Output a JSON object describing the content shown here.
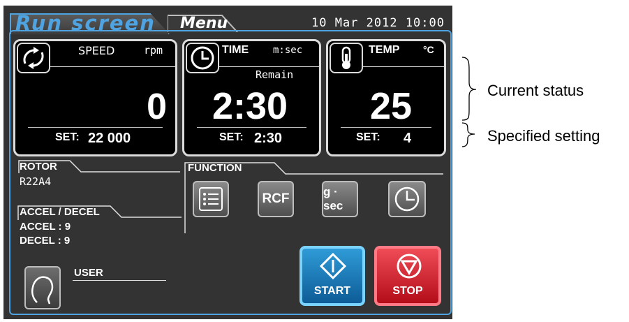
{
  "header": {
    "run_tab": "Run screen",
    "menu_tab": "Menu",
    "datetime": "10 Mar 2012 10:00"
  },
  "speed": {
    "label": "SPEED",
    "unit": "rpm",
    "value": "0",
    "set_label": "SET:",
    "set_value": "22 000",
    "icon": "rotation-icon"
  },
  "time": {
    "label": "TIME",
    "unit": "m:sec",
    "sublabel": "Remain",
    "value": "2:30",
    "set_label": "SET:",
    "set_value": "2:30",
    "icon": "clock-icon"
  },
  "temp": {
    "label": "TEMP",
    "unit": "°C",
    "value": "25",
    "set_label": "SET:",
    "set_value": "4",
    "icon": "thermometer-icon"
  },
  "rotor": {
    "label": "ROTOR",
    "value": "R22A4"
  },
  "accel_decel": {
    "label": "ACCEL / DECEL",
    "accel": "ACCEL : 9",
    "decel": "DECEL : 9"
  },
  "function": {
    "label": "FUNCTION",
    "buttons": [
      {
        "label": "",
        "icon": "list-icon"
      },
      {
        "label": "RCF",
        "icon": ""
      },
      {
        "label": "g · sec",
        "icon": ""
      },
      {
        "label": "",
        "icon": "timer-icon"
      }
    ]
  },
  "user": {
    "label": "USER",
    "icon": "user-head-icon"
  },
  "controls": {
    "start_label": "START",
    "stop_label": "STOP"
  },
  "annotations": {
    "current_status": "Current status",
    "specified_setting": "Specified setting"
  },
  "colors": {
    "background": "#333333",
    "accent_blue": "#4fa3e0",
    "start_blue": "#1a7fbf",
    "stop_red": "#d7212f"
  }
}
